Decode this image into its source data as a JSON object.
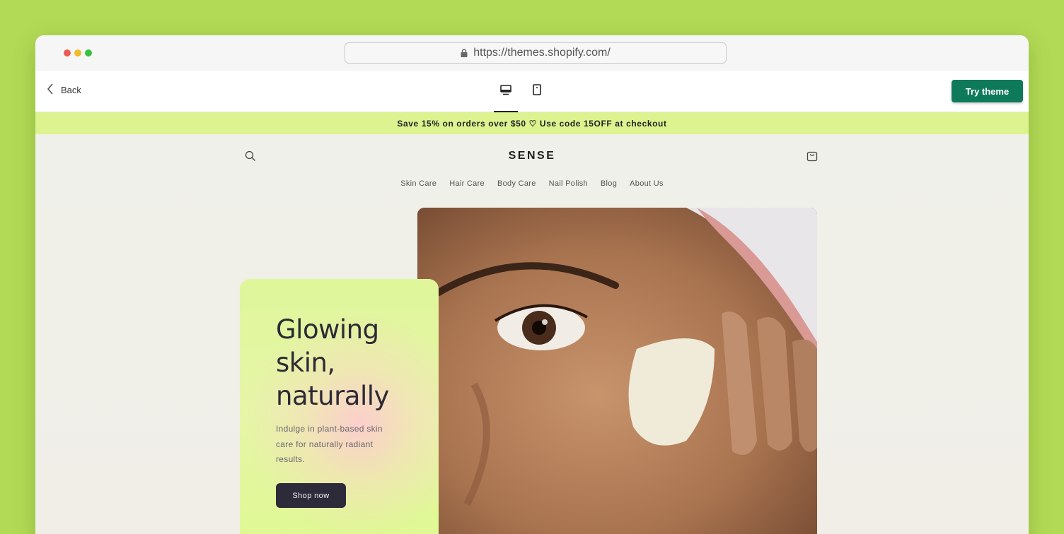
{
  "browser": {
    "url": "https://themes.shopify.com/"
  },
  "topbar": {
    "back_label": "Back",
    "try_theme_label": "Try theme",
    "devices": [
      "desktop-icon",
      "mobile-icon"
    ],
    "active_device": "desktop"
  },
  "announcement": {
    "text": "Save 15% on orders over $50 ♡ Use code 15OFF at checkout"
  },
  "store": {
    "brand": "SENSE",
    "nav": [
      "Skin Care",
      "Hair Care",
      "Body Care",
      "Nail Polish",
      "Blog",
      "About Us"
    ],
    "hero": {
      "heading": "Glowing skin, naturally",
      "body": "Indulge in plant-based skin care for naturally radiant results.",
      "cta": "Shop now"
    }
  },
  "colors": {
    "page_bg": "#b3da56",
    "announcement_bg": "#dcf38f",
    "try_theme_bg": "#0f7a5a",
    "cta_bg": "#2d2a3a"
  }
}
